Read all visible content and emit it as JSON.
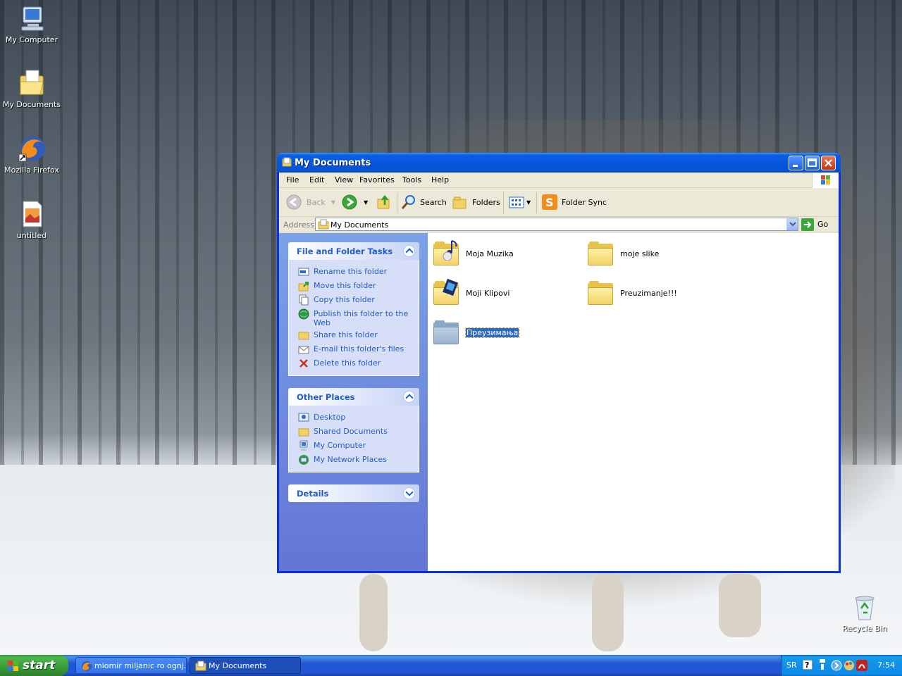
{
  "desktop": {
    "icons": [
      {
        "label": "My Computer",
        "icon": "my-computer-icon"
      },
      {
        "label": "My Documents",
        "icon": "my-documents-icon"
      },
      {
        "label": "Mozilla Firefox",
        "icon": "firefox-icon"
      },
      {
        "label": "untitled",
        "icon": "image-file-icon"
      },
      {
        "label": "Recycle Bin",
        "icon": "recycle-bin-icon"
      }
    ]
  },
  "window": {
    "title": "My Documents",
    "menu": [
      "File",
      "Edit",
      "View",
      "Favorites",
      "Tools",
      "Help"
    ],
    "toolbar": {
      "back": "Back",
      "search": "Search",
      "folders": "Folders",
      "folder_sync": "Folder Sync"
    },
    "address": {
      "label": "Address",
      "value": "My Documents",
      "go": "Go"
    },
    "tasks_panel": {
      "title": "File and Folder Tasks",
      "items": [
        "Rename this folder",
        "Move this folder",
        "Copy this folder",
        "Publish this folder to the Web",
        "Share this folder",
        "E-mail this folder's files",
        "Delete this folder"
      ]
    },
    "places_panel": {
      "title": "Other Places",
      "items": [
        "Desktop",
        "Shared Documents",
        "My Computer",
        "My Network Places"
      ]
    },
    "details_panel": {
      "title": "Details"
    },
    "folders": [
      {
        "name": "Moja Muzika",
        "icon": "music-folder-icon"
      },
      {
        "name": "moje slike",
        "icon": "folder-icon"
      },
      {
        "name": "Moji Klipovi",
        "icon": "video-folder-icon"
      },
      {
        "name": "Preuzimanje!!!",
        "icon": "folder-icon"
      },
      {
        "name": "Преузимања",
        "icon": "folder-icon",
        "selected": true
      }
    ]
  },
  "taskbar": {
    "start": "start",
    "tasks": [
      {
        "label": "miomir miljanic ro ognj...",
        "icon": "firefox-icon"
      },
      {
        "label": "My Documents",
        "icon": "folder-icon",
        "active": true
      }
    ],
    "tray": {
      "language": "SR",
      "time": "7:54"
    }
  }
}
